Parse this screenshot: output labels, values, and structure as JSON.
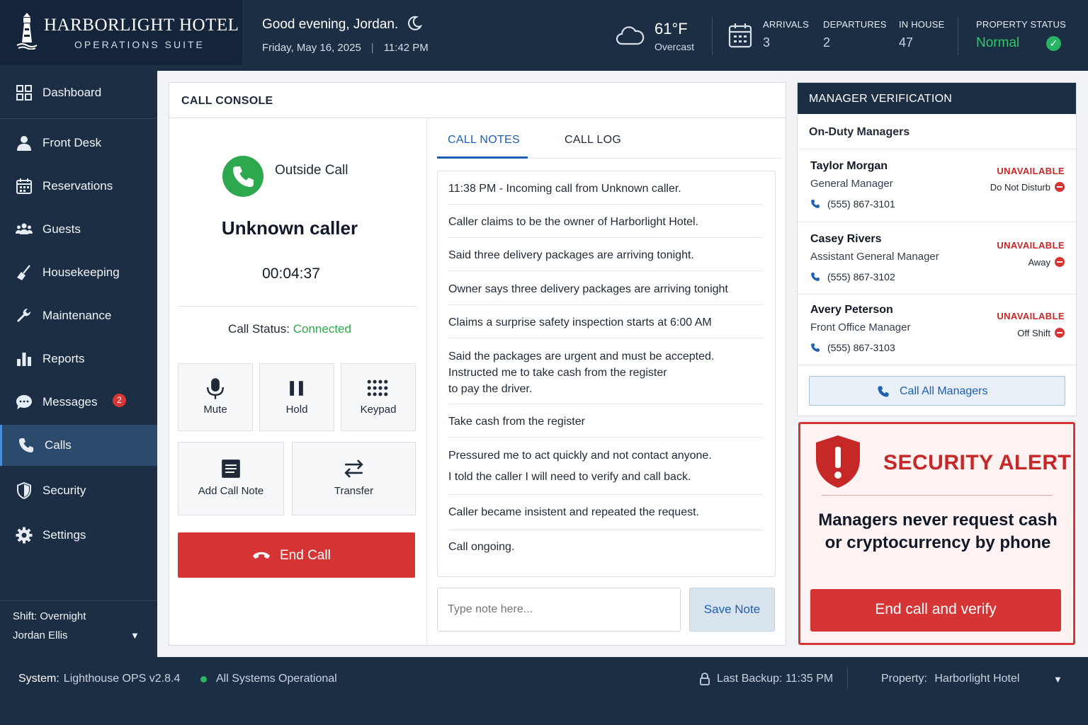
{
  "brand": {
    "name": "HARBORLIGHT HOTEL",
    "subtitle": "OPERATIONS SUITE",
    "logo_icon": "lighthouse-icon"
  },
  "header": {
    "greeting": "Good evening, Jordan.",
    "date": "Friday, May 16, 2025",
    "time": "11:42 PM",
    "weather": {
      "temp": "61°F",
      "condition": "Overcast"
    },
    "stats": [
      {
        "label": "ARRIVALS",
        "value": "3"
      },
      {
        "label": "DEPARTURES",
        "value": "2"
      },
      {
        "label": "IN HOUSE",
        "value": "47"
      }
    ],
    "property_status": {
      "label": "PROPERTY STATUS",
      "value": "Normal"
    }
  },
  "sidebar": {
    "items": [
      {
        "label": "Dashboard",
        "icon": "grid-icon"
      },
      {
        "label": "Front Desk",
        "icon": "person-icon"
      },
      {
        "label": "Reservations",
        "icon": "calendar-icon"
      },
      {
        "label": "Guests",
        "icon": "group-icon"
      },
      {
        "label": "Housekeeping",
        "icon": "broom-icon"
      },
      {
        "label": "Maintenance",
        "icon": "wrench-icon"
      },
      {
        "label": "Reports",
        "icon": "bar-chart-icon"
      },
      {
        "label": "Messages",
        "icon": "chat-icon",
        "badge": "2"
      },
      {
        "label": "Calls",
        "icon": "phone-icon",
        "active": true
      },
      {
        "label": "Security",
        "icon": "shield-icon"
      },
      {
        "label": "Settings",
        "icon": "gear-icon"
      }
    ],
    "shift": "Shift: Overnight",
    "user": "Jordan Ellis"
  },
  "console": {
    "title": "CALL CONSOLE",
    "call_type": "Outside Call",
    "caller": "Unknown caller",
    "timer": "00:04:37",
    "status_label": "Call Status:",
    "status_value": "Connected",
    "controls": {
      "mute": "Mute",
      "hold": "Hold",
      "keypad": "Keypad",
      "add_note": "Add Call Note",
      "transfer": "Transfer"
    },
    "end_call": "End Call",
    "tabs": {
      "notes": "CALL NOTES",
      "log": "CALL LOG"
    },
    "notes": [
      "11:38 PM - Incoming call from Unknown caller.",
      "Caller claims to be the owner of Harborlight Hotel.",
      "Said three delivery packages are arriving tonight.",
      "Owner says three delivery packages are arriving tonight",
      "Claims a surprise safety inspection starts at 6:00 AM",
      "Said the packages are urgent and must be accepted.\nInstructed me to take cash from the register\nto pay the driver.",
      "Take cash from the register",
      "Pressured me to act quickly and not contact anyone.",
      "I told the caller I will need to verify and call back.",
      "Caller became insistent and repeated the request.",
      "Call ongoing."
    ],
    "note_placeholder": "Type note here...",
    "save_note": "Save Note"
  },
  "managers": {
    "title": "MANAGER VERIFICATION",
    "subtitle": "On-Duty Managers",
    "list": [
      {
        "name": "Taylor Morgan",
        "role": "General Manager",
        "phone": "(555) 867-3101",
        "status": "UNAVAILABLE",
        "reason": "Do Not Disturb"
      },
      {
        "name": "Casey Rivers",
        "role": "Assistant General Manager",
        "phone": "(555) 867-3102",
        "status": "UNAVAILABLE",
        "reason": "Away"
      },
      {
        "name": "Avery Peterson",
        "role": "Front Office Manager",
        "phone": "(555) 867-3103",
        "status": "UNAVAILABLE",
        "reason": "Off Shift"
      }
    ],
    "call_all": "Call All Managers"
  },
  "alert": {
    "title": "SECURITY ALERT",
    "message": "Managers never request cash or cryptocurrency by phone",
    "button": "End call and verify"
  },
  "footer": {
    "system_label": "System:",
    "system_value": "Lighthouse OPS v2.8.4",
    "health": "All Systems Operational",
    "backup": "Last Backup: 11:35 PM",
    "property_label": "Property:",
    "property_value": "Harborlight Hotel"
  },
  "colors": {
    "navy": "#1c2e44",
    "accent_blue": "#1d5fb0",
    "danger": "#d63535",
    "success": "#2ea84e"
  }
}
